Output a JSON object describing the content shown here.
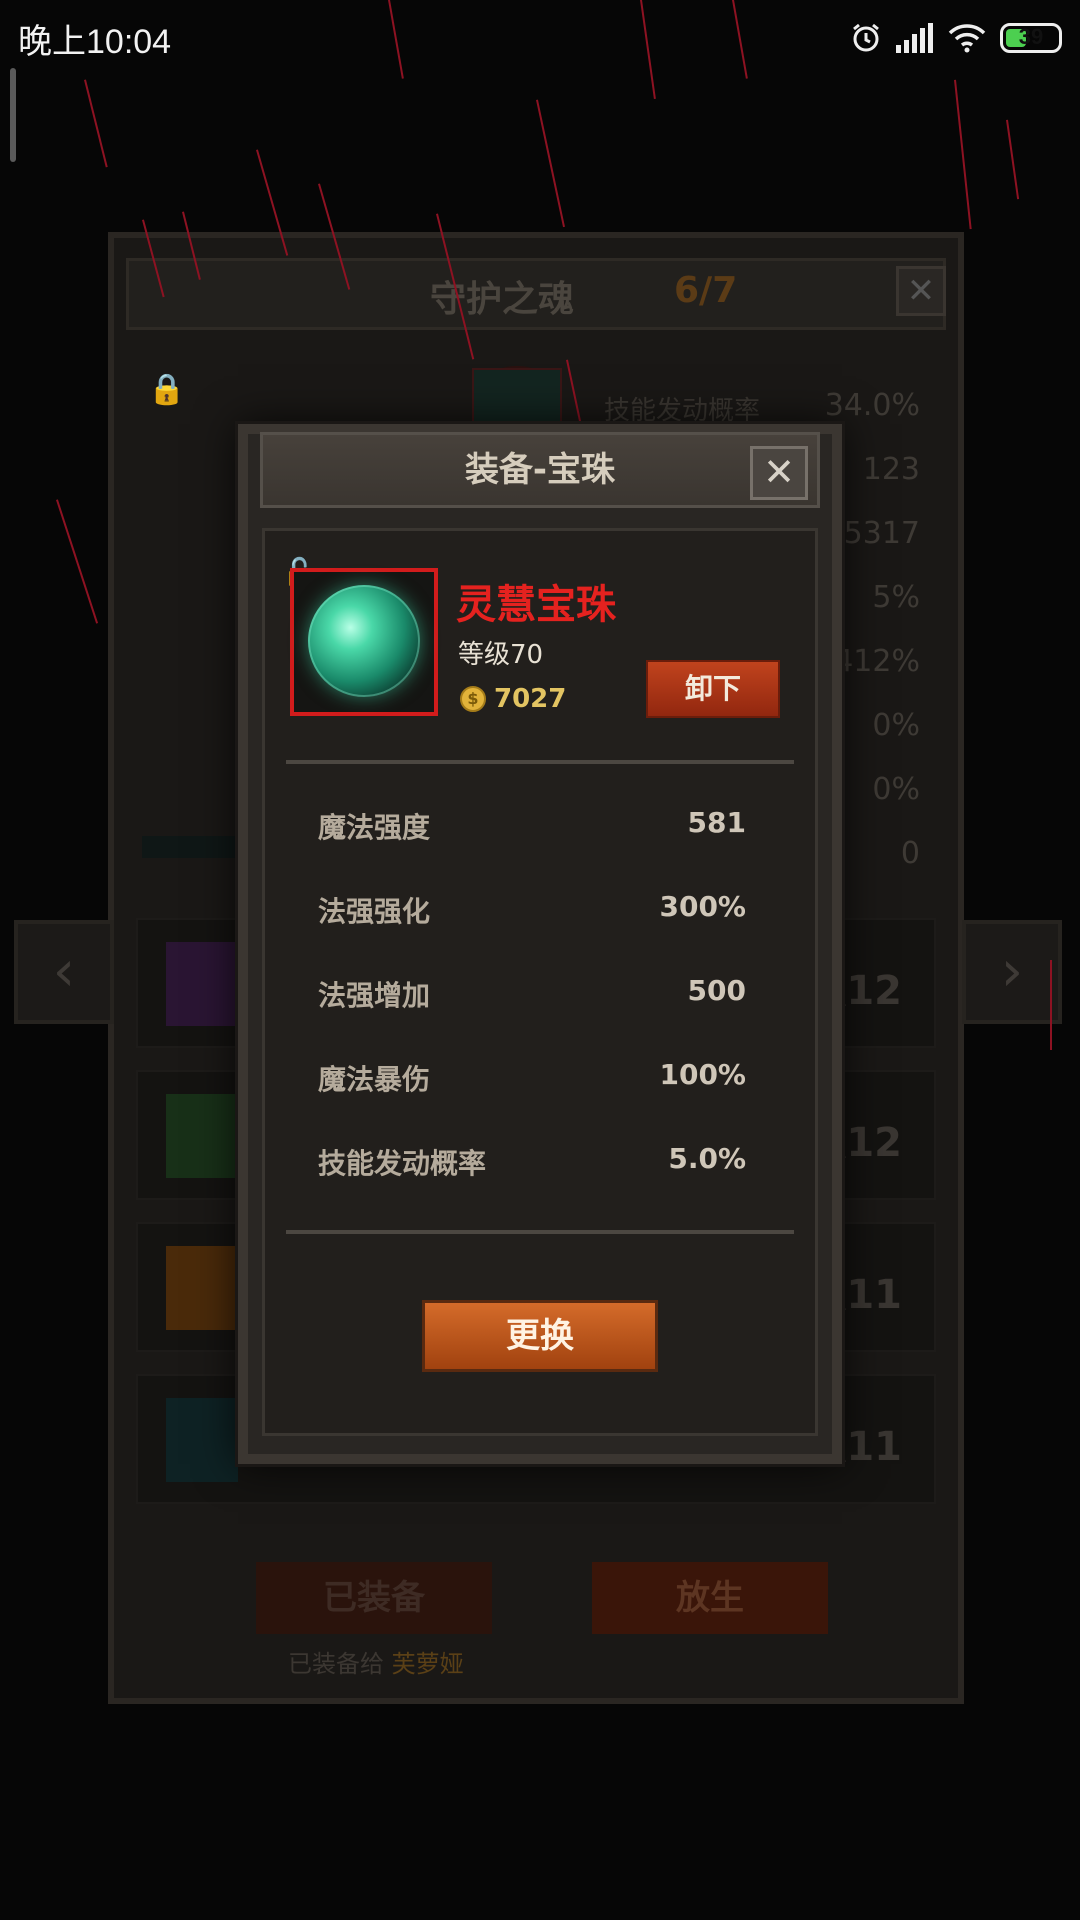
{
  "status_bar": {
    "time": "晚上10:04",
    "battery": "39"
  },
  "background_panel": {
    "title": "守护之魂",
    "count": "6/7",
    "close_glyph": "✕",
    "partial_label": "技能发动概率",
    "stats": [
      "34.0%",
      "123",
      "5317",
      "5%",
      "412%",
      "0%",
      "0%",
      "0"
    ],
    "item_levels": [
      "级12",
      "级12",
      "级11",
      "级11"
    ],
    "equipped_button": "已装备",
    "release_button": "放生",
    "equipped_to_prefix": "已装备给",
    "equipped_to_name": "芙萝娅"
  },
  "modal": {
    "title": "装备-宝珠",
    "close_glyph": "✕",
    "item": {
      "name": "灵慧宝珠",
      "level": "等级70",
      "price": "7027",
      "coin_symbol": "$"
    },
    "unequip_button": "卸下",
    "stats": [
      {
        "label": "魔法强度",
        "value": "581"
      },
      {
        "label": "法强强化",
        "value": "300%"
      },
      {
        "label": "法强增加",
        "value": "500"
      },
      {
        "label": "魔法暴伤",
        "value": "100%"
      },
      {
        "label": "技能发动概率",
        "value": "5.0%"
      }
    ],
    "replace_button": "更换"
  },
  "colors": {
    "item_name": "#e5221f",
    "item_frame": "#d21c1c",
    "price": "#e3c462",
    "primary_button": "#c0431d"
  }
}
